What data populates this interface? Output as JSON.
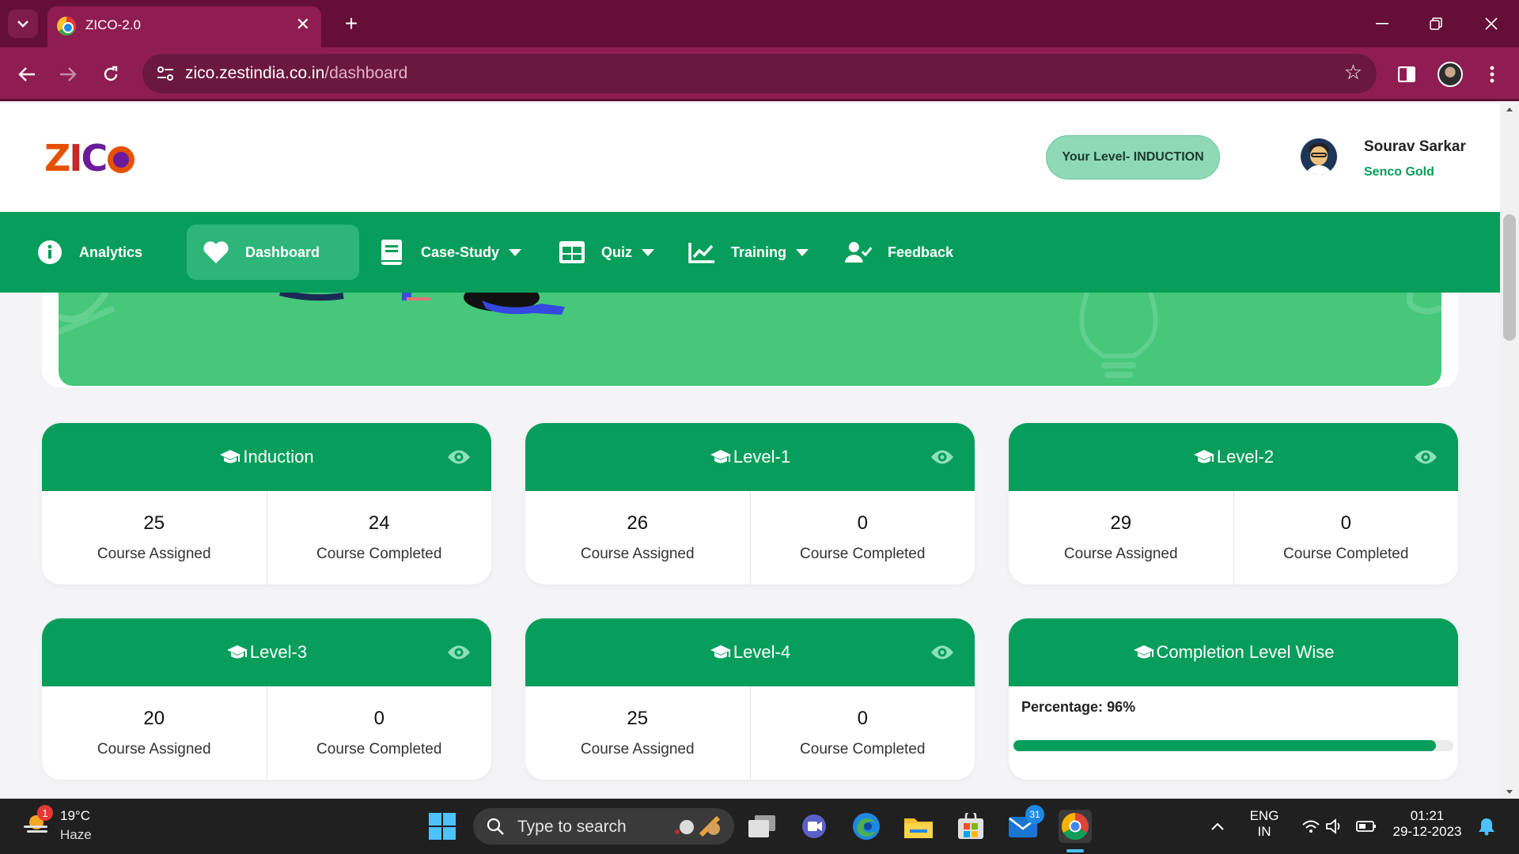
{
  "browser": {
    "tab_title": "ZICO-2.0",
    "url_host": "zico.zestindia.co.in",
    "url_path": "/dashboard"
  },
  "header": {
    "level_badge": "Your Level- INDUCTION",
    "user_name": "Sourav Sarkar",
    "user_company": "Senco Gold"
  },
  "nav": {
    "items": [
      {
        "label": "Analytics"
      },
      {
        "label": "Dashboard"
      },
      {
        "label": "Case-Study"
      },
      {
        "label": "Quiz"
      },
      {
        "label": "Training"
      },
      {
        "label": "Feedback"
      }
    ]
  },
  "cards": [
    {
      "title": "Induction",
      "assigned": "25",
      "completed": "24",
      "assigned_label": "Course Assigned",
      "completed_label": "Course Completed"
    },
    {
      "title": "Level-1",
      "assigned": "26",
      "completed": "0",
      "assigned_label": "Course Assigned",
      "completed_label": "Course Completed"
    },
    {
      "title": "Level-2",
      "assigned": "29",
      "completed": "0",
      "assigned_label": "Course Assigned",
      "completed_label": "Course Completed"
    },
    {
      "title": "Level-3",
      "assigned": "20",
      "completed": "0",
      "assigned_label": "Course Assigned",
      "completed_label": "Course Completed"
    },
    {
      "title": "Level-4",
      "assigned": "25",
      "completed": "0",
      "assigned_label": "Course Assigned",
      "completed_label": "Course Completed"
    }
  ],
  "completion": {
    "title": "Completion Level Wise",
    "percentage_label": "Percentage:",
    "percentage_value": "96%",
    "progress_fraction": 0.96
  },
  "colors": {
    "brand_green": "#079e5b",
    "browser_frame": "#8f1d52",
    "level_badge_bg": "#8fd9b6",
    "company_text": "#0a9d58"
  },
  "taskbar": {
    "weather_temp": "19°C",
    "weather_condition": "Haze",
    "weather_badge": "1",
    "search_placeholder": "Type to search",
    "mail_badge": "31",
    "lang_1": "ENG",
    "lang_2": "IN",
    "time": "01:21",
    "date": "29-12-2023"
  }
}
